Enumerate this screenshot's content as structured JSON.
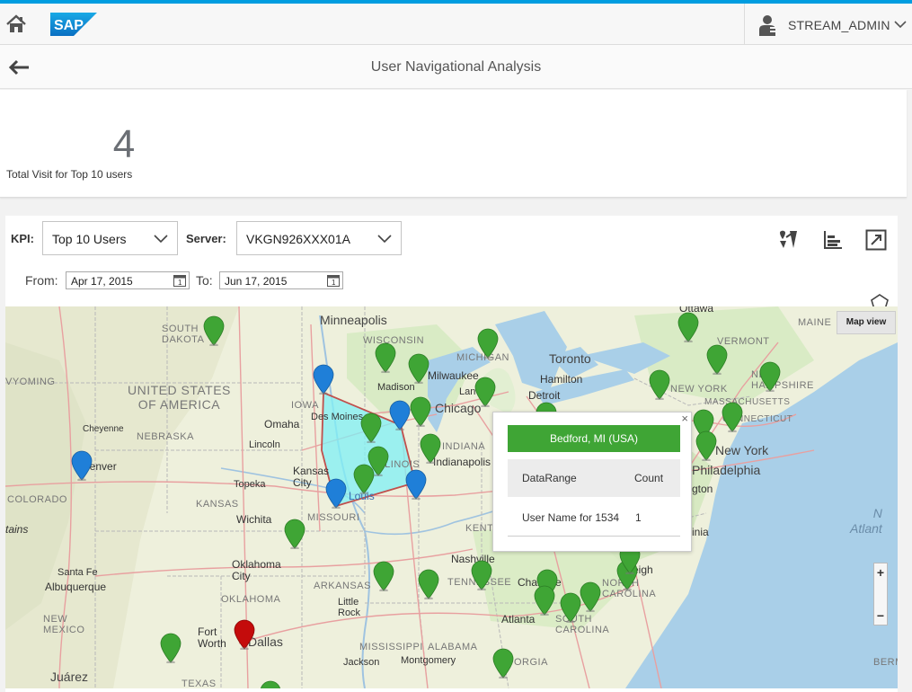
{
  "shell": {
    "user_name": "STREAM_ADMIN",
    "logo_text": "SAP"
  },
  "page": {
    "title": "User Navigational Analysis"
  },
  "kpi_tile": {
    "value": "4",
    "label": "Total Visit for Top 10 users"
  },
  "filters": {
    "kpi_label": "KPI:",
    "kpi_value": "Top 10 Users",
    "server_label": "Server:",
    "server_value": "VKGN926XXX01A",
    "from_label": "From:",
    "from_value": "Apr 17, 2015",
    "to_label": "To:",
    "to_value": "Jun 17, 2015"
  },
  "map": {
    "map_view_label": "Map view",
    "labels": {
      "minneapolis": "Minneapolis",
      "south_dakota": "SOUTH\nDAKOTA",
      "wisconsin": "WISCONSIN",
      "united_states": "UNITED STATES\nOF AMERICA",
      "wyoming": "VYOMING",
      "iowa": "IOWA",
      "des_moines": "Des Moines",
      "madison": "Madison",
      "milwaukee": "Milwaukee",
      "michigan": "MICHIGAN",
      "toronto": "Toronto",
      "hamilton": "Hamilton",
      "detroit": "Detroit",
      "lansing": "Lan",
      "chicago": "Chicago",
      "ottawa": "Ottawa",
      "maine": "MAINE",
      "vermont": "VERMONT",
      "new_york_state": "NEW YORK",
      "new_hampshire": "NEW\nHAMPSHIRE",
      "massachusetts": "MASSACHUSETTS",
      "connecticut": "CONNECTICUT",
      "cheyenne": "Cheyenne",
      "nebraska": "NEBRASKA",
      "omaha": "Omaha",
      "lincoln": "Lincoln",
      "denver": "Denver",
      "illinois": "ILLINOIS",
      "indiana": "INDIANA",
      "indianapolis": "Indianapolis",
      "kansas_city": "Kansas\nCity",
      "topeka": "Topeka",
      "st_louis": "Louis",
      "colorado": "COLORADO",
      "kansas": "KANSAS",
      "missouri": "MISSOURI",
      "wichita": "Wichita",
      "mountains": "tains",
      "kentucky": "KENT",
      "oklahoma_city": "Oklahoma\nCity",
      "santa_fe": "Santa Fe",
      "albuquerque": "Albuquerque",
      "oklahoma": "OKLAHOMA",
      "arkansas": "ARKANSAS",
      "little_rock": "Little\nRock",
      "nashville": "Nashville",
      "tennessee": "TENNESSEE",
      "charlotte": "Charlotte",
      "north_carolina": "NORTH\nCAROLINA",
      "raleigh": "eigh",
      "atlanta": "Atlanta",
      "south_carolina": "SOUTH\nCAROLINA",
      "new_mexico": "NEW\nMEXICO",
      "fort_worth": "Fort\nWorth",
      "dallas": "Dallas",
      "mississippi": "MISSISSIPPI",
      "alabama": "ALABAMA",
      "jackson": "Jackson",
      "montgomery": "Montgomery",
      "georgia": "ORGIA",
      "texas": "TEXAS",
      "juarez": "Juárez",
      "new_york": "New York",
      "philadelphia": "Philadelphia",
      "washington": "gton",
      "virginia": "inia",
      "atlantic": "N\nAtlant",
      "bermuda": "BERM"
    }
  },
  "popup": {
    "title": "Bedford, MI (USA)",
    "col_range": "DataRange",
    "col_count": "Count",
    "row_name": "User Name for 1534",
    "row_count": "1",
    "close": "×"
  },
  "colors": {
    "green_pin": "#3fa535",
    "blue_pin": "#1f7fd8",
    "red_pin": "#c40b0b",
    "selection_fill": "#7ff0f5",
    "accent": "#009de0"
  },
  "icons": {
    "home": "home-icon",
    "user": "user-icon",
    "back": "back-arrow-icon",
    "map_tool": "map-pin-tool-icon",
    "chart_tool": "bar-chart-icon",
    "fullscreen": "fullscreen-icon",
    "lasso": "pentagon-lasso-icon",
    "calendar": "calendar-icon"
  }
}
